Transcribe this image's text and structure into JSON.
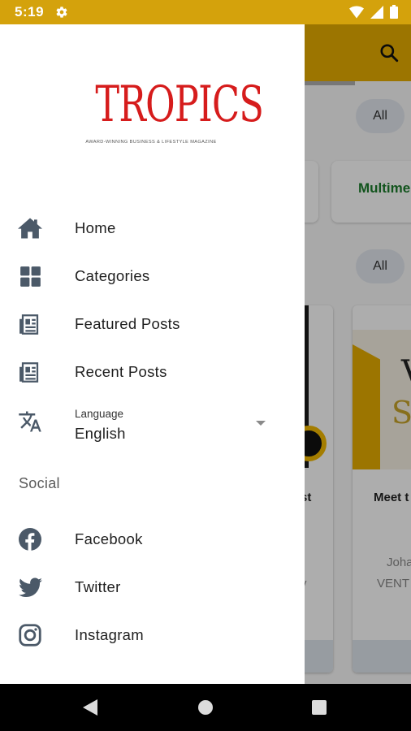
{
  "status_bar": {
    "time": "5:19"
  },
  "background_app": {
    "chips": [
      "All",
      "All"
    ],
    "category_label": "Multime",
    "posts": [
      {
        "title": "st",
        "meta": "y"
      },
      {
        "title": "Meet t",
        "author": "Joha",
        "org": "VENT",
        "cover_text_1": "V",
        "cover_text_2": "SA"
      }
    ]
  },
  "drawer": {
    "logo_text": "TROPICS",
    "logo_tagline": "AWARD-WINNING BUSINESS & LIFESTYLE MAGAZINE",
    "menu": [
      {
        "label": "Home",
        "icon": "home-icon"
      },
      {
        "label": "Categories",
        "icon": "grid-icon"
      },
      {
        "label": "Featured Posts",
        "icon": "newspaper-icon"
      },
      {
        "label": "Recent Posts",
        "icon": "newspaper-icon"
      }
    ],
    "language": {
      "caption": "Language",
      "value": "English",
      "icon": "translate-icon"
    },
    "social_header": "Social",
    "social": [
      {
        "label": "Facebook",
        "icon": "facebook-icon"
      },
      {
        "label": "Twitter",
        "icon": "twitter-icon"
      },
      {
        "label": "Instagram",
        "icon": "instagram-icon"
      }
    ]
  },
  "colors": {
    "accent": "#E6AD00",
    "status_bar": "#D4A20C",
    "logo_red": "#D61C1C",
    "icon_gray": "#4B5968"
  }
}
